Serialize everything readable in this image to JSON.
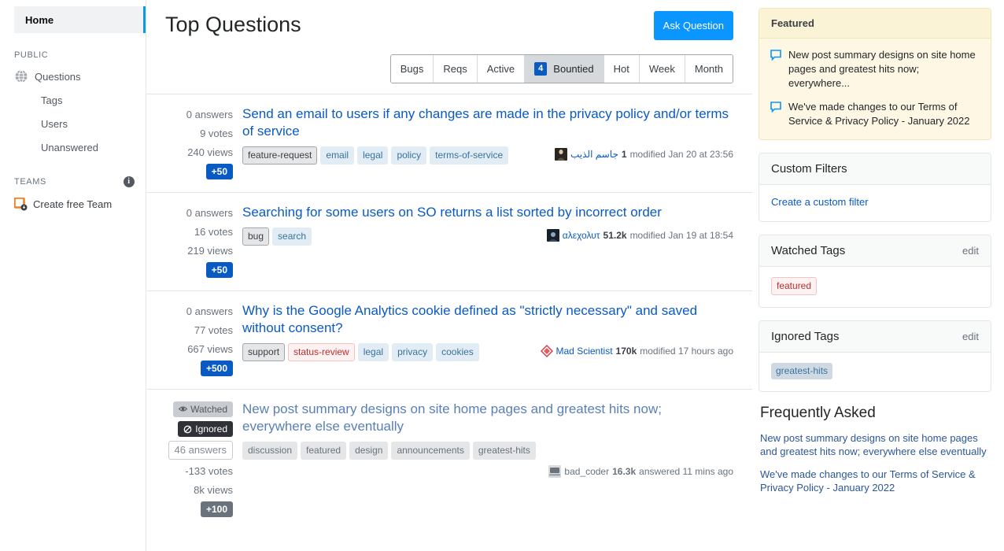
{
  "sidebar": {
    "home_label": "Home",
    "public_label": "PUBLIC",
    "teams_label": "TEAMS",
    "items": [
      {
        "label": "Questions",
        "icon": "globe-icon"
      },
      {
        "label": "Tags",
        "icon": ""
      },
      {
        "label": "Users",
        "icon": ""
      },
      {
        "label": "Unanswered",
        "icon": ""
      }
    ],
    "create_team_label": "Create free Team"
  },
  "header": {
    "title": "Top Questions",
    "ask_button": "Ask Question"
  },
  "tabs": [
    {
      "label": "Bugs",
      "selected": false,
      "count": ""
    },
    {
      "label": "Reqs",
      "selected": false,
      "count": ""
    },
    {
      "label": "Active",
      "selected": false,
      "count": ""
    },
    {
      "label": "Bountied",
      "selected": true,
      "count": "4"
    },
    {
      "label": "Hot",
      "selected": false,
      "count": ""
    },
    {
      "label": "Week",
      "selected": false,
      "count": ""
    },
    {
      "label": "Month",
      "selected": false,
      "count": ""
    }
  ],
  "questions": [
    {
      "answers": "0 answers",
      "votes": "9 votes",
      "views": "240 views",
      "bounty": "+50",
      "title": "Send an email to users if any changes are made in the privacy policy and/or terms of service",
      "tags": [
        {
          "label": "feature-request",
          "style": "required"
        },
        {
          "label": "email",
          "style": "normal"
        },
        {
          "label": "legal",
          "style": "normal"
        },
        {
          "label": "policy",
          "style": "normal"
        },
        {
          "label": "terms-of-service",
          "style": "normal"
        }
      ],
      "user": "جاسم الذيب",
      "rep": "1",
      "activity": "modified Jan 20 at 23:56"
    },
    {
      "answers": "0 answers",
      "votes": "16 votes",
      "views": "219 views",
      "bounty": "+50",
      "title": "Searching for some users on SO returns a list sorted by incorrect order",
      "tags": [
        {
          "label": "bug",
          "style": "required"
        },
        {
          "label": "search",
          "style": "normal"
        }
      ],
      "user": "αλεχολυτ",
      "rep": "51.2k",
      "activity": "modified Jan 19 at 18:54"
    },
    {
      "answers": "0 answers",
      "votes": "77 votes",
      "views": "667 views",
      "bounty": "+500",
      "title": "Why is the Google Analytics cookie defined as \"strictly necessary\" and saved without consent?",
      "tags": [
        {
          "label": "support",
          "style": "required"
        },
        {
          "label": "status-review",
          "style": "status"
        },
        {
          "label": "legal",
          "style": "normal"
        },
        {
          "label": "privacy",
          "style": "normal"
        },
        {
          "label": "cookies",
          "style": "normal"
        }
      ],
      "user": "Mad Scientist",
      "rep": "170k",
      "activity": "modified 17 hours ago"
    },
    {
      "watched_badge": "Watched",
      "ignored_badge": "Ignored",
      "answers": "46 answers",
      "votes": "-133 votes",
      "views": "8k views",
      "bounty": "+100",
      "title": "New post summary designs on site home pages and greatest hits now; everywhere else eventually",
      "tags": [
        {
          "label": "discussion",
          "style": "grey"
        },
        {
          "label": "featured",
          "style": "grey"
        },
        {
          "label": "design",
          "style": "grey"
        },
        {
          "label": "announcements",
          "style": "grey"
        },
        {
          "label": "greatest-hits",
          "style": "grey"
        }
      ],
      "user": "bad_coder",
      "rep": "16.3k",
      "activity": "answered 11 mins ago"
    }
  ],
  "rightbar": {
    "featured": {
      "title": "Featured",
      "items": [
        "New post summary designs on site home pages and greatest hits now; everywhere...",
        "We've made changes to our Terms of Service & Privacy Policy - January 2022"
      ]
    },
    "custom_filters": {
      "title": "Custom Filters",
      "link": "Create a custom filter"
    },
    "watched_tags": {
      "title": "Watched Tags",
      "edit": "edit",
      "tags": [
        "featured"
      ]
    },
    "ignored_tags": {
      "title": "Ignored Tags",
      "edit": "edit",
      "tags": [
        "greatest-hits"
      ]
    },
    "frequently_asked": {
      "title": "Frequently Asked",
      "items": [
        "New post summary designs on site home pages and greatest hits now; everywhere else eventually",
        "We've made changes to our Terms of Service & Privacy Policy - January 2022"
      ]
    }
  },
  "colors": {
    "accent_blue": "#0a95ff",
    "link_blue": "#0a5ac3",
    "bounty_blue": "#0a5ac3",
    "featured_bg": "#fdf7e3",
    "sidebar_active_border": "#0c9ae0",
    "teams_orange": "#f48024"
  }
}
